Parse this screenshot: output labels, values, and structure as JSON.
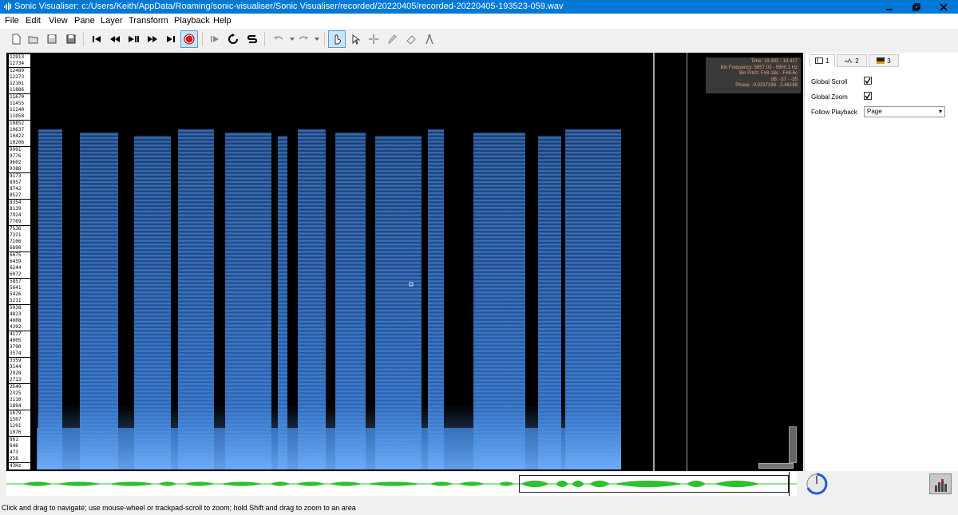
{
  "window": {
    "title": "Sonic Visualiser: c:/Users/Keith/AppData/Roaming/sonic-visualiser/Sonic Visualiser/recorded/20220405/recorded-20220405-193523-059.wav"
  },
  "menu": [
    "File",
    "Edit",
    "View",
    "Pane",
    "Layer",
    "Transform",
    "Playback",
    "Help"
  ],
  "toolbar": {
    "groups": [
      "new",
      "open",
      "save",
      "save-as",
      "rewind-start",
      "rewind",
      "play-pause",
      "fast-forward",
      "forward-end",
      "record",
      "constrained",
      "loop",
      "solo",
      "undo",
      "redo",
      "navigate",
      "select",
      "move",
      "draw",
      "erase",
      "measure"
    ]
  },
  "frequency_scale": [
    "12913",
    "12734",
    "12489",
    "12273",
    "12101",
    "11886",
    "11670",
    "11455",
    "11240",
    "11058",
    "10852",
    "10637",
    "10422",
    "10206",
    "9991",
    "9776",
    "9602",
    "9388",
    "9173",
    "8957",
    "8742",
    "8527",
    "8354",
    "8139",
    "7924",
    "7709",
    "7536",
    "7321",
    "7106",
    "6890",
    "6675",
    "6459",
    "6244",
    "6072",
    "5857",
    "5641",
    "5426",
    "5211",
    "5038",
    "4823",
    "4608",
    "4392",
    "4177",
    "4005",
    "3790",
    "3574",
    "3359",
    "3144",
    "2928",
    "2713",
    "2540",
    "2325",
    "2110",
    "1894",
    "1679",
    "1507",
    "1291",
    "1076",
    "861",
    "646",
    "473",
    "258",
    "43Hz"
  ],
  "info_box": {
    "time": "Time: 19.382 - 19.417",
    "bin_frequency": "Bin Frequency: 5857.03 - 5900.1 Hz",
    "bin_pitch": "Bin Pitch: F#8-18c - F#8-6c",
    "db": "dB: -37 - -35",
    "phase": "Phase: -0.0237198 - 2.46188"
  },
  "property_tabs": [
    {
      "label": "1",
      "icon": "pane-icon"
    },
    {
      "label": "2",
      "icon": "waveform-icon"
    },
    {
      "label": "3",
      "icon": "spectrogram-icon"
    }
  ],
  "properties": {
    "global_scroll_label": "Global Scroll",
    "global_scroll_checked": true,
    "global_zoom_label": "Global Zoom",
    "global_zoom_checked": true,
    "follow_playback_label": "Follow Playback",
    "follow_playback_value": "Page"
  },
  "status": {
    "text": "Click and drag to navigate; use mouse-wheel or trackpad-scroll to zoom; hold Shift and drag to zoom to an area"
  },
  "colors": {
    "titlebar": "#0078d7",
    "spectrogram": "#3b7fd4",
    "waveform": "#2ec02e",
    "info_text": "#f0a070"
  }
}
